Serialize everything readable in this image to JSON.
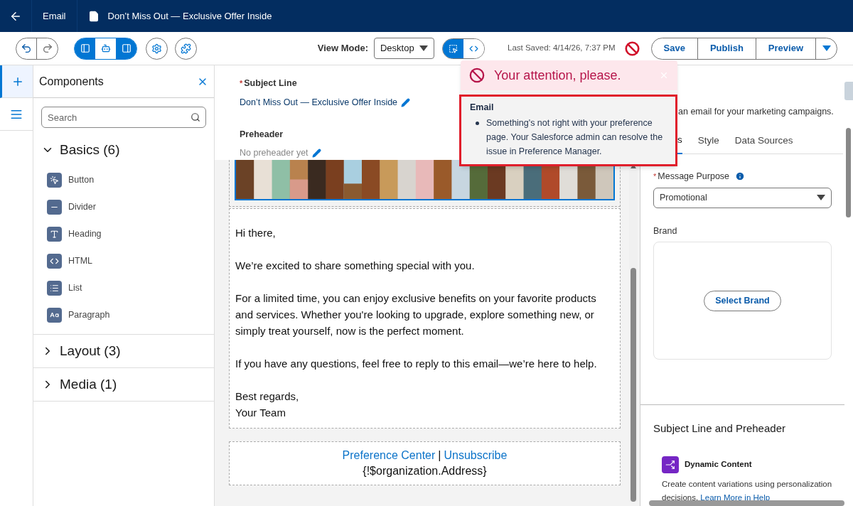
{
  "header": {
    "breadcrumb": "Email",
    "title": "Don’t Miss Out — Exclusive Offer Inside"
  },
  "toolbar": {
    "panel_toggles": [
      {
        "selected": true
      },
      {
        "selected": false
      },
      {
        "selected": true
      }
    ],
    "view_mode_label": "View Mode:",
    "view_mode": "Desktop",
    "view_toggles": [
      {
        "selected": true
      },
      {
        "selected": false
      }
    ],
    "last_saved": "Last Saved: 4/14/26, 7:37 PM",
    "actions": [
      "Save",
      "Publish",
      "Preview"
    ]
  },
  "rail": [
    {
      "selected": true
    },
    {
      "selected": false
    }
  ],
  "components_panel": {
    "title": "Components",
    "search_placeholder": "Search",
    "groups": [
      {
        "label": "Basics (6)",
        "expanded": true,
        "items": [
          {
            "kind": "button",
            "label": "Button"
          },
          {
            "kind": "divider",
            "label": "Divider"
          },
          {
            "kind": "heading",
            "label": "Heading"
          },
          {
            "kind": "html",
            "label": "HTML"
          },
          {
            "kind": "list",
            "label": "List"
          },
          {
            "kind": "paragraph",
            "label": "Paragraph"
          }
        ]
      },
      {
        "label": "Layout (3)",
        "expanded": false
      },
      {
        "label": "Media (1)",
        "expanded": false
      }
    ]
  },
  "subject": {
    "required_mark": "*",
    "label": "Subject Line",
    "value": "Don’t Miss Out — Exclusive Offer Inside",
    "preheader_label": "Preheader",
    "preheader_placeholder": "No preheader yet"
  },
  "email_body": {
    "paragraphs": [
      [
        "Hi there,"
      ],
      [
        "We’re excited to share something special with you."
      ],
      [
        "For a limited time, you can enjoy exclusive benefits on your favorite products and services. Whether you're looking to upgrade, explore something new, or simply treat yourself, now is the perfect moment."
      ],
      [
        "If you have any questions, feel free to reply to this email—we’re here to help."
      ],
      [
        "Best regards,",
        "Your Team"
      ]
    ]
  },
  "footer": {
    "links": [
      "Preference Center",
      "Unsubscribe"
    ],
    "separator": "|",
    "address": "{!$organization.Address}"
  },
  "alert": {
    "title": "Your attention, please.",
    "section": "Email",
    "messages": [
      "Something's not right with your preference page. Your Salesforce admin can resolve the issue in Preference Manager."
    ]
  },
  "properties": {
    "description": "an email for your marketing campaigns.",
    "tabs": [
      {
        "label": "s",
        "selected": true
      },
      {
        "label": "Style",
        "selected": false
      },
      {
        "label": "Data Sources",
        "selected": false
      }
    ],
    "message_purpose": {
      "required_mark": "*",
      "label": "Message Purpose",
      "value": "Promotional"
    },
    "brand": {
      "label": "Brand",
      "button": "Select Brand"
    },
    "section_title": "Subject Line and Preheader",
    "feature": {
      "title": "Dynamic Content",
      "description": "Create content variations using personalization decisions.",
      "link": "Learn More in Help"
    }
  }
}
